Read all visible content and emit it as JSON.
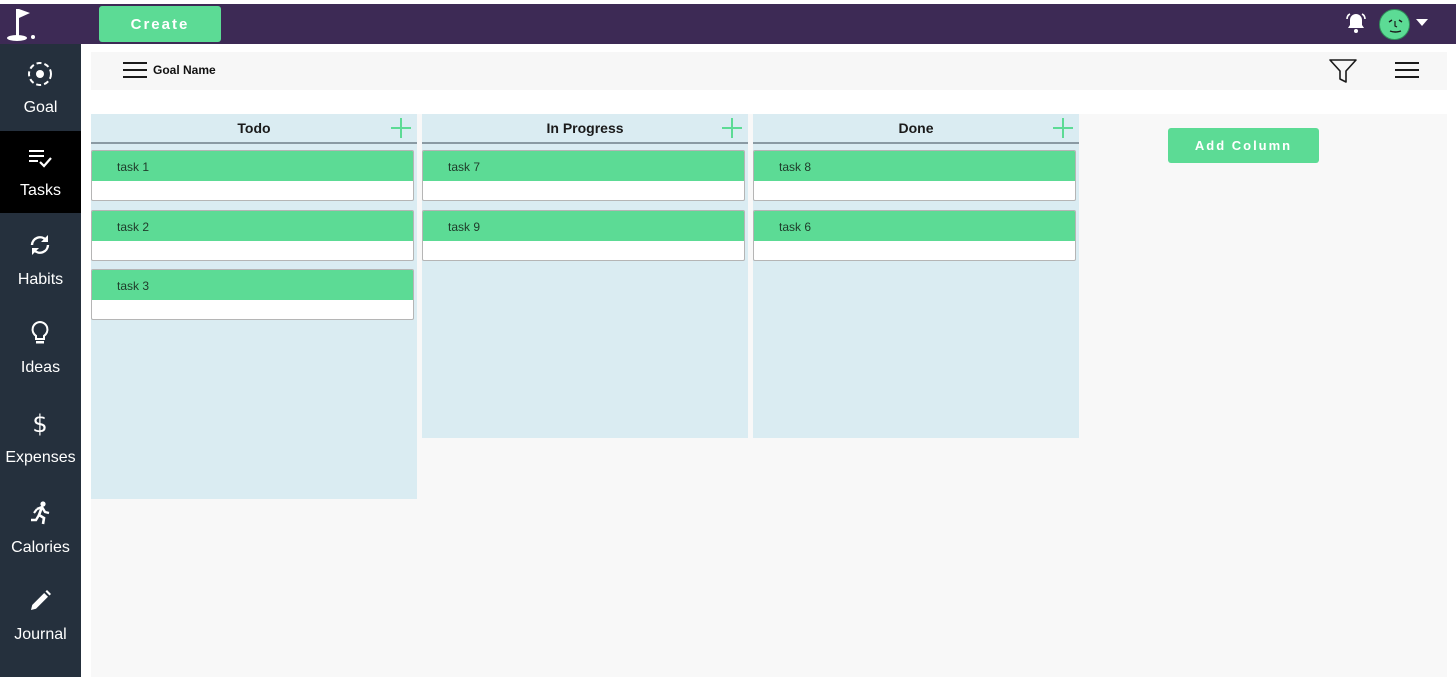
{
  "header": {
    "create_label": "Create",
    "brand_color": "#3d2a55",
    "accent_color": "#5cdb95"
  },
  "sidebar": {
    "items": [
      {
        "label": "Goal",
        "icon": "goal-icon"
      },
      {
        "label": "Tasks",
        "icon": "tasks-icon",
        "active": true
      },
      {
        "label": "Habits",
        "icon": "habits-icon"
      },
      {
        "label": "Ideas",
        "icon": "lightbulb-icon"
      },
      {
        "label": "Expenses",
        "icon": "dollar-icon"
      },
      {
        "label": "Calories",
        "icon": "running-icon"
      },
      {
        "label": "Journal",
        "icon": "pencil-icon"
      }
    ]
  },
  "toolbar": {
    "goal_name": "Goal Name"
  },
  "board": {
    "columns": [
      {
        "title": "Todo",
        "cards": [
          "task 1",
          "task 2",
          "task 3"
        ]
      },
      {
        "title": "In Progress",
        "cards": [
          "task 7",
          "task 9"
        ]
      },
      {
        "title": "Done",
        "cards": [
          "task 8",
          "task 6"
        ]
      }
    ],
    "add_column_label": "Add Column"
  }
}
